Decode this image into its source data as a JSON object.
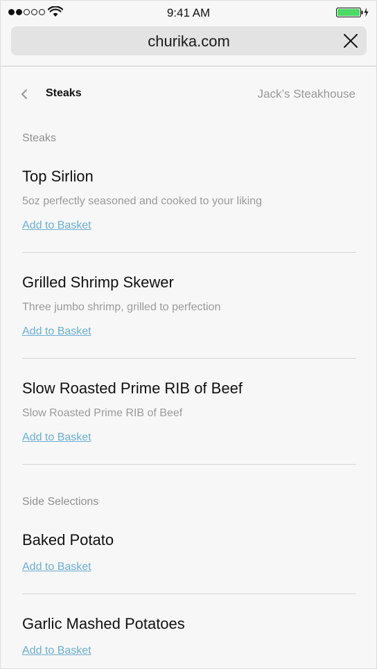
{
  "status_bar": {
    "time": "9:41 AM",
    "signal_bars_filled": 2,
    "signal_bars_total": 5,
    "battery_color": "#4cd964"
  },
  "browser": {
    "url": "churika.com",
    "close_icon": "close-icon"
  },
  "nav": {
    "back_icon": "chevron-left-icon",
    "title": "Steaks",
    "restaurant": "Jack’s Steakhouse"
  },
  "menu": {
    "section_steaks": "Steaks",
    "section_sides": "Side Selections",
    "add_label": "Add to Basket",
    "steaks": [
      {
        "name": "Top Sirlion",
        "description": "5oz perfectly seasoned and cooked to your liking"
      },
      {
        "name": "Grilled Shrimp Skewer",
        "description": "Three jumbo shrimp, grilled to perfection"
      },
      {
        "name": "Slow Roasted Prime RIB of Beef",
        "description": "Slow Roasted Prime RIB of Beef"
      }
    ],
    "sides": [
      {
        "name": "Baked Potato"
      },
      {
        "name": "Garlic Mashed Potatoes"
      }
    ]
  },
  "colors": {
    "link": "#6aaed6",
    "muted_text": "#9a9a9a",
    "background": "#f7f7f7"
  }
}
